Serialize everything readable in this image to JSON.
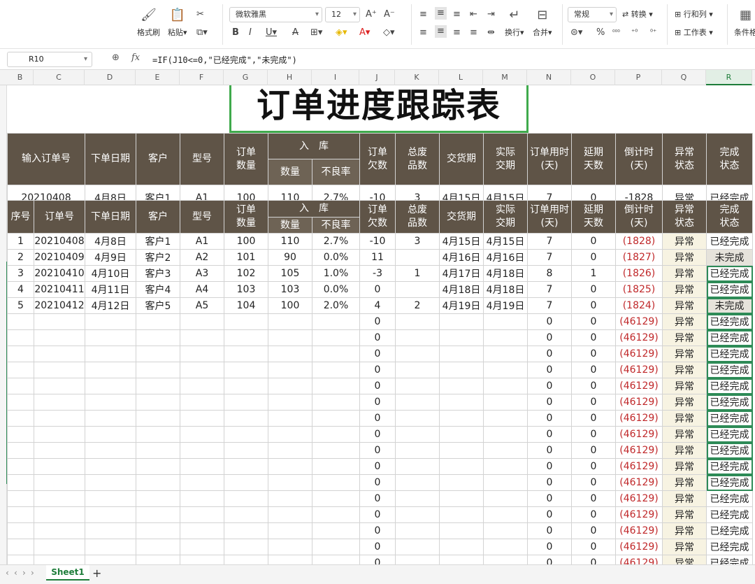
{
  "ribbon": {
    "format_painter": "格式刷",
    "paste": "粘贴",
    "font_name": "微软雅黑",
    "font_size": "12",
    "wrap": "换行",
    "merge": "合并",
    "number_format": "常规",
    "convert": "转换",
    "rows_cols": "行和列",
    "worksheet": "工作表",
    "conditional": "条件格"
  },
  "formula_bar": {
    "cell_ref": "R10",
    "fx": "fx",
    "formula": "=IF(J10<=0,\"已经完成\",\"未完成\")"
  },
  "columns": [
    "B",
    "C",
    "D",
    "E",
    "F",
    "G",
    "H",
    "I",
    "J",
    "K",
    "L",
    "M",
    "N",
    "O",
    "P",
    "Q",
    "R"
  ],
  "title": "订单进度跟踪表",
  "summary": {
    "headers": {
      "order_no": "输入订单号",
      "date": "下单日期",
      "customer": "客户",
      "model": "型号",
      "qty": "订单\n数量",
      "stock": "入　库",
      "stock_qty": "数量",
      "defect": "不良率",
      "owed": "订单\n欠数",
      "scrap": "总废\n品数",
      "delivery": "交货期",
      "actual": "实际\n交期",
      "days_used": "订单用时\n(天)",
      "delay": "延期\n天数",
      "countdown": "倒计时\n(天)",
      "abnormal": "异常\n状态",
      "done": "完成\n状态"
    },
    "values": [
      "20210408",
      "4月8日",
      "客户1",
      "A1",
      "100",
      "110",
      "2.7%",
      "-10",
      "3",
      "4月15日",
      "4月15日",
      "7",
      "0",
      "-1828",
      "异常",
      "已经完成"
    ]
  },
  "detail": {
    "headers": {
      "seq": "序号",
      "order_no": "订单号",
      "date": "下单日期",
      "customer": "客户",
      "model": "型号",
      "qty": "订单\n数量",
      "stock": "入　库",
      "stock_qty": "数量",
      "defect": "不良率",
      "owed": "订单\n欠数",
      "scrap": "总废\n品数",
      "delivery": "交货期",
      "actual": "实际\n交期",
      "days_used": "订单用时\n(天)",
      "delay": "延期\n天数",
      "countdown": "倒计时\n(天)",
      "abnormal": "异常\n状态",
      "done": "完成\n状态"
    },
    "rows": [
      [
        "1",
        "20210408",
        "4月8日",
        "客户1",
        "A1",
        "100",
        "110",
        "2.7%",
        "-10",
        "3",
        "4月15日",
        "4月15日",
        "7",
        "0",
        "(1828)",
        "异常",
        "已经完成"
      ],
      [
        "2",
        "20210409",
        "4月9日",
        "客户2",
        "A2",
        "101",
        "90",
        "0.0%",
        "11",
        "",
        "4月16日",
        "4月16日",
        "7",
        "0",
        "(1827)",
        "异常",
        "未完成"
      ],
      [
        "3",
        "20210410",
        "4月10日",
        "客户3",
        "A3",
        "102",
        "105",
        "1.0%",
        "-3",
        "1",
        "4月17日",
        "4月18日",
        "8",
        "1",
        "(1826)",
        "异常",
        "已经完成"
      ],
      [
        "4",
        "20210411",
        "4月11日",
        "客户4",
        "A4",
        "103",
        "103",
        "0.0%",
        "0",
        "",
        "4月18日",
        "4月18日",
        "7",
        "0",
        "(1825)",
        "异常",
        "已经完成"
      ],
      [
        "5",
        "20210412",
        "4月12日",
        "客户5",
        "A5",
        "104",
        "100",
        "2.0%",
        "4",
        "2",
        "4月19日",
        "4月19日",
        "7",
        "0",
        "(1824)",
        "异常",
        "未完成"
      ]
    ],
    "empty_row": {
      "owed": "0",
      "days_used": "0",
      "delay": "0",
      "countdown": "(46129)",
      "abnormal": "异常",
      "done": "已经完成"
    },
    "empty_row_count": 16
  },
  "tabs": {
    "sheet": "Sheet1",
    "add": "+"
  }
}
